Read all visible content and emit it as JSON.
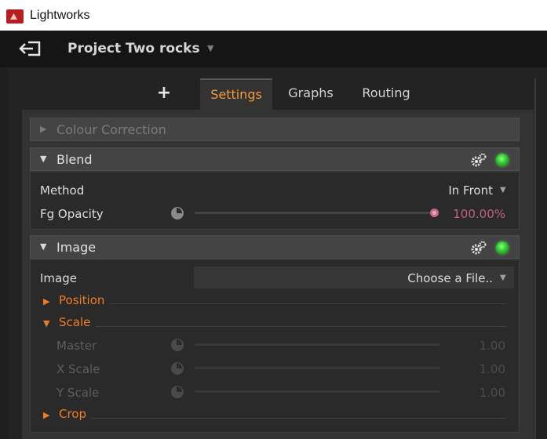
{
  "window": {
    "title": "Lightworks"
  },
  "project": {
    "title": "Project Two rocks",
    "caret": "▼"
  },
  "tabs": {
    "add": "+",
    "settings": "Settings",
    "graphs": "Graphs",
    "routing": "Routing"
  },
  "sections": {
    "colour_correction": {
      "label": "Colour Correction",
      "expanded": false
    },
    "blend": {
      "label": "Blend",
      "expanded": true,
      "method_label": "Method",
      "method_value": "In Front",
      "opacity_label": "Fg Opacity",
      "opacity_value": "100.00%",
      "opacity_level": 1.0
    },
    "image": {
      "label": "Image",
      "expanded": true,
      "image_label": "Image",
      "image_value": "Choose a File..",
      "position_label": "Position",
      "scale_label": "Scale",
      "master_label": "Master",
      "master_value": "1.00",
      "xscale_label": "X Scale",
      "xscale_value": "1.00",
      "yscale_label": "Y Scale",
      "yscale_value": "1.00",
      "crop_label": "Crop"
    }
  },
  "icons": {
    "expand": "▶",
    "collapse": "▼",
    "dropdown": "▼"
  },
  "colors": {
    "accent_orange": "#ee7d22",
    "tab_active": "#f49a3c",
    "led_green": "#2fcb2f",
    "handle_pink": "#c86a82"
  }
}
